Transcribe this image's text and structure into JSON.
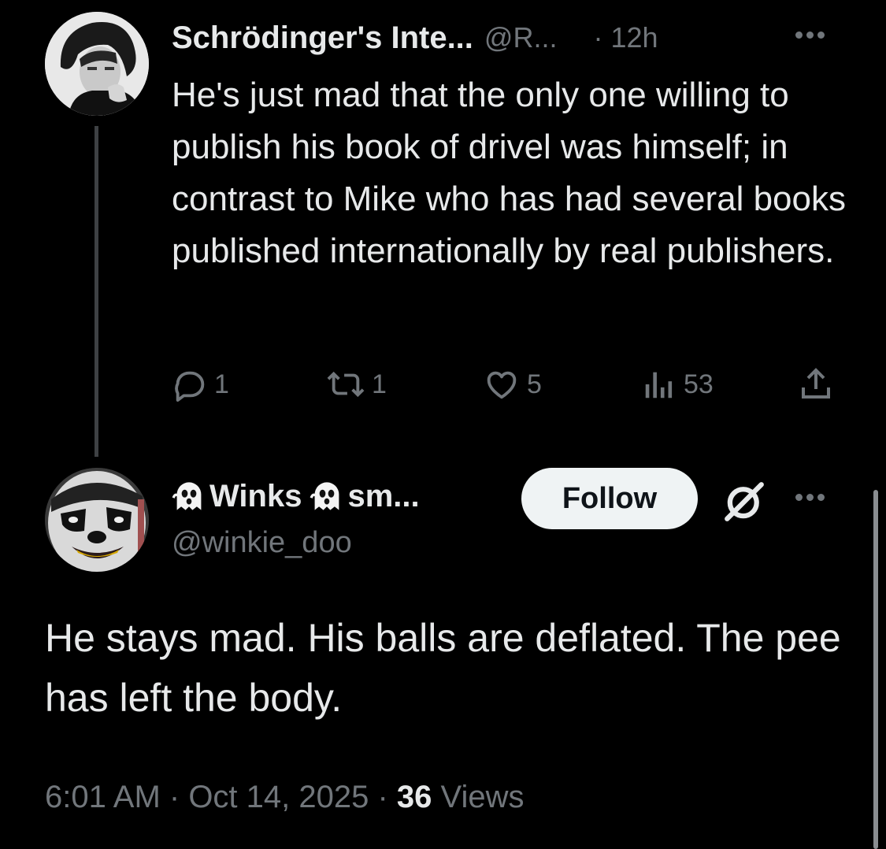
{
  "parent_tweet": {
    "display_name": "Schrödinger's Inte...",
    "handle": "@R...",
    "time": "· 12h",
    "text": "He's just mad that the only one willing to publish his book of drivel was himself; in contrast to Mike who has had several books published internationally by real publishers.",
    "actions": {
      "reply_count": "1",
      "repost_count": "1",
      "like_count": "5",
      "views_count": "53"
    },
    "icons": [
      "reply-icon",
      "repost-icon",
      "like-icon",
      "views-icon",
      "share-icon",
      "more-icon"
    ]
  },
  "reply_tweet": {
    "display_name": "Winks",
    "display_name_suffix": "sm...",
    "handle": "@winkie_doo",
    "follow_label": "Follow",
    "text": "He stays mad. His balls are deflated. The pee has left the body.",
    "time": "6:01 AM",
    "date": "Oct 14, 2025",
    "separator": " · ",
    "views_count": "36",
    "views_label": "Views",
    "icons": [
      "ghost-emoji-icon",
      "grok-icon",
      "more-icon"
    ]
  },
  "colors": {
    "background": "#000000",
    "primary_text": "#e7e9ea",
    "secondary_text": "#71767b",
    "follow_button_bg": "#eff3f4",
    "thread_line": "#3e4144"
  }
}
